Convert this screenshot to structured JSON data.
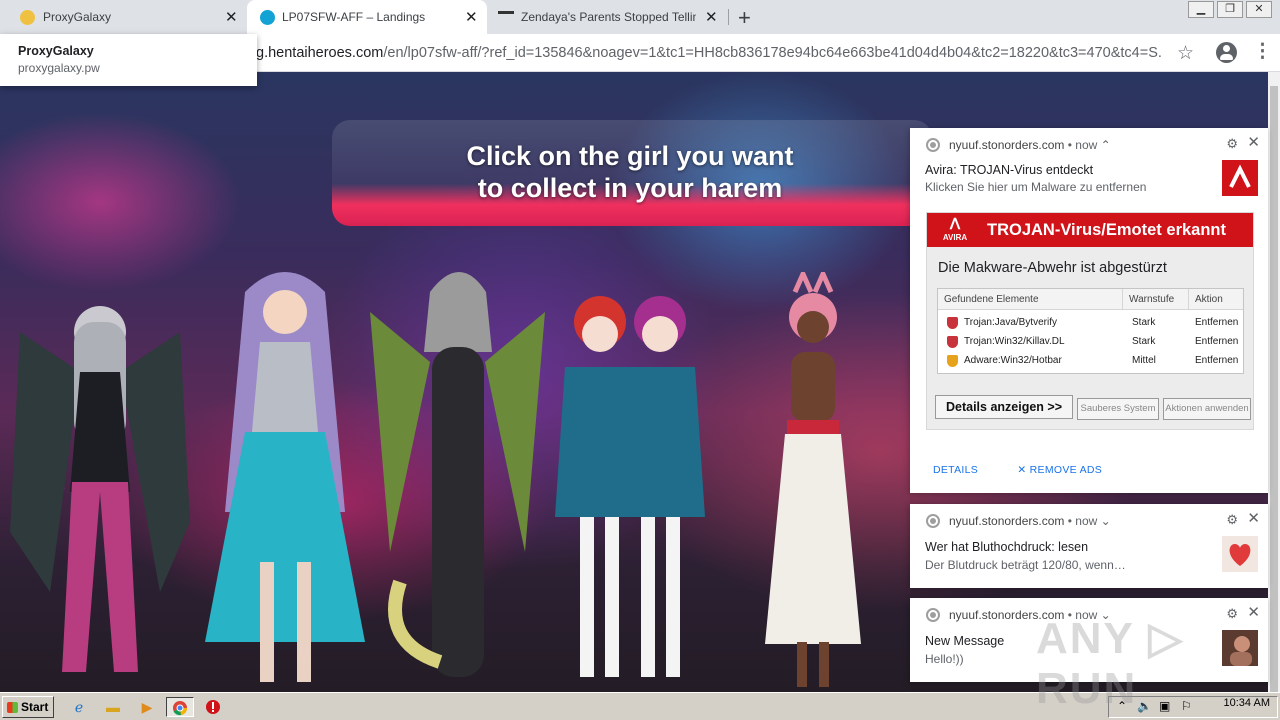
{
  "tabs": [
    {
      "title": "ProxyGalaxy",
      "close": "✕"
    },
    {
      "title": "LP07SFW-AFF – Landings",
      "close": "✕"
    },
    {
      "title": "Zendaya's Parents Stopped Telling H",
      "close": "✕"
    }
  ],
  "newtab": "+",
  "url": {
    "pre": "g.hentaiheroes.com",
    "rest": "/en/lp07sfw-aff/?ref_id=135846&noagev=1&tc1=HH8cb836178e94bc64e663be41d04d4b04&tc2=18220&tc3=470&tc4=S..."
  },
  "tooltip": {
    "title": "ProxyGalaxy",
    "domain": "proxygalaxy.pw"
  },
  "banner": {
    "line1": "Click on the girl you want",
    "line2": "to collect in your harem"
  },
  "notifications": [
    {
      "domain": "nyuuf.stonorders.com",
      "time": "• now ⌃",
      "title": "Avira: TROJAN-Virus entdeckt",
      "body": "Klicken Sie hier um Malware zu entfernen"
    },
    {
      "domain": "nyuuf.stonorders.com",
      "time": "• now ⌄",
      "title": "Wer hat Bluthochdruck: lesen",
      "body": "Der Blutdruck beträgt 120/80, wenn…"
    },
    {
      "domain": "nyuuf.stonorders.com",
      "time": "• now ⌄",
      "title": "New Message",
      "body": "Hello!))"
    }
  ],
  "avira": {
    "logo": "AVIRA",
    "heading": "TROJAN-Virus/Emotet erkannt",
    "subheading": "Die Makware-Abwehr ist abgestürzt",
    "headers": [
      "Gefundene Elemente",
      "Warnstufe",
      "Aktion"
    ],
    "rows": [
      {
        "name": "Trojan:Java/Bytverify",
        "level": "Stark",
        "action": "Entfernen"
      },
      {
        "name": "Trojan:Win32/Killav.DL",
        "level": "Stark",
        "action": "Entfernen"
      },
      {
        "name": "Adware:Win32/Hotbar",
        "level": "Mittel",
        "action": "Entfernen"
      }
    ],
    "btn_details": "Details anzeigen >>",
    "btn_clean": "Sauberes System",
    "btn_apply": "Aktionen anwenden"
  },
  "links": {
    "details": "DETAILS",
    "remove": "✕ REMOVE ADS"
  },
  "watermark": "ANY ▷ RUN",
  "taskbar": {
    "start": "Start",
    "clock": "10:34 AM"
  }
}
